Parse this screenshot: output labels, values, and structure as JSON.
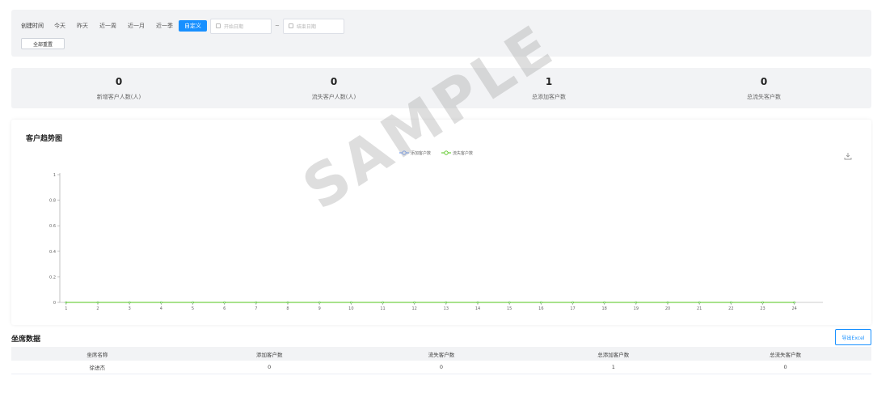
{
  "filter": {
    "label": "创建时间",
    "ranges": [
      "今天",
      "昨天",
      "近一周",
      "近一月",
      "近一季",
      "自定义"
    ],
    "active_range": "自定义",
    "start_placeholder": "开始日期",
    "separator": "~",
    "end_placeholder": "结束日期",
    "reset_label": "全部重置"
  },
  "stats": [
    {
      "value": "0",
      "label": "新增客户人数(人)"
    },
    {
      "value": "0",
      "label": "流失客户人数(人)"
    },
    {
      "value": "1",
      "label": "总添加客户数"
    },
    {
      "value": "0",
      "label": "总流失客户数"
    }
  ],
  "chart": {
    "title": "客户趋势图",
    "download_icon": "download-icon"
  },
  "chart_data": {
    "type": "line",
    "x": [
      "1",
      "2",
      "3",
      "4",
      "5",
      "6",
      "7",
      "8",
      "9",
      "10",
      "11",
      "12",
      "13",
      "14",
      "15",
      "16",
      "17",
      "18",
      "19",
      "20",
      "21",
      "22",
      "23",
      "24"
    ],
    "series": [
      {
        "name": "添加客户数",
        "color": "#5b8ff9",
        "values": [
          0,
          0,
          0,
          0,
          0,
          0,
          0,
          0,
          0,
          0,
          0,
          0,
          0,
          0,
          0,
          0,
          0,
          0,
          0,
          0,
          0,
          0,
          0,
          0
        ]
      },
      {
        "name": "流失客户数",
        "color": "#52c41a",
        "values": [
          0,
          0,
          0,
          0,
          0,
          0,
          0,
          0,
          0,
          0,
          0,
          0,
          0,
          0,
          0,
          0,
          0,
          0,
          0,
          0,
          0,
          0,
          0,
          0
        ]
      }
    ],
    "yticks": [
      "0",
      "0.2",
      "0.4",
      "0.6",
      "0.8",
      "1"
    ],
    "ylim": [
      0,
      1
    ],
    "legend_position": "top-center",
    "grid": false
  },
  "seat": {
    "title": "坐席数据",
    "export_label": "导出Excel",
    "columns": [
      "坐席名称",
      "添加客户数",
      "流失客户数",
      "总添加客户数",
      "总流失客户数"
    ],
    "rows": [
      [
        "徐进杰",
        "0",
        "0",
        "1",
        "0"
      ]
    ]
  },
  "watermark": "SAMPLE"
}
